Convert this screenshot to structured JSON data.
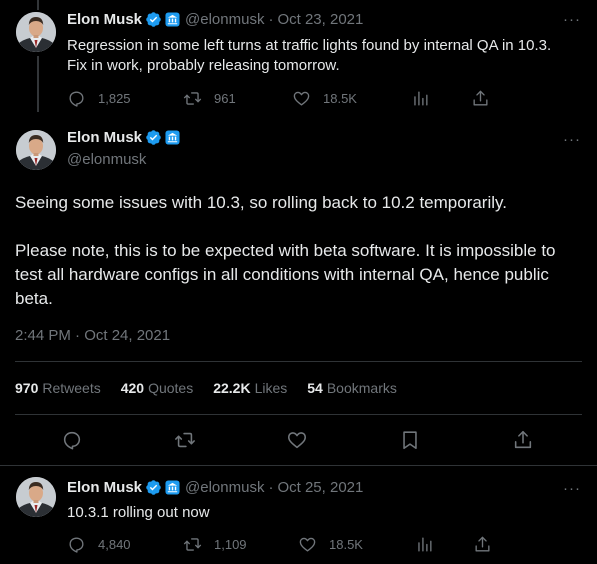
{
  "tweet1": {
    "name": "Elon Musk",
    "handle": "@elonmusk",
    "date": "Oct 23, 2021",
    "text_line1": "Regression in some left turns at traffic lights found by internal QA in 10.3.",
    "text_line2": "Fix in work, probably releasing tomorrow.",
    "replies": "1,825",
    "retweets": "961",
    "likes": "18.5K"
  },
  "main_tweet": {
    "name": "Elon Musk",
    "handle": "@elonmusk",
    "paragraph1": "Seeing some issues with 10.3, so rolling back to 10.2 temporarily.",
    "paragraph2_line1": "Please note, this is to be expected with beta software. It is impossible to",
    "paragraph2_line2": "test all hardware configs in all conditions with internal QA, hence public",
    "paragraph2_line3": "beta.",
    "timestamp": "2:44 PM · Oct 24, 2021",
    "stats": {
      "retweets_count": "970",
      "retweets_label": "Retweets",
      "quotes_count": "420",
      "quotes_label": "Quotes",
      "likes_count": "22.2K",
      "likes_label": "Likes",
      "bookmarks_count": "54",
      "bookmarks_label": "Bookmarks"
    }
  },
  "tweet3": {
    "name": "Elon Musk",
    "handle": "@elonmusk",
    "date": "Oct 25, 2021",
    "text": "10.3.1 rolling out now",
    "replies": "4,840",
    "retweets": "1,109",
    "likes": "18.5K"
  },
  "ui": {
    "more_glyph": "···",
    "separator": "·"
  },
  "colors": {
    "background": "#000000",
    "text": "#e7e9ea",
    "secondary": "#71767b",
    "verified": "#1d9bf0",
    "border": "#2f3336"
  },
  "icons": [
    "reply-icon",
    "retweet-icon",
    "like-icon",
    "views-icon",
    "share-icon",
    "bookmark-icon",
    "verified-badge-icon",
    "government-badge-icon",
    "more-icon"
  ]
}
